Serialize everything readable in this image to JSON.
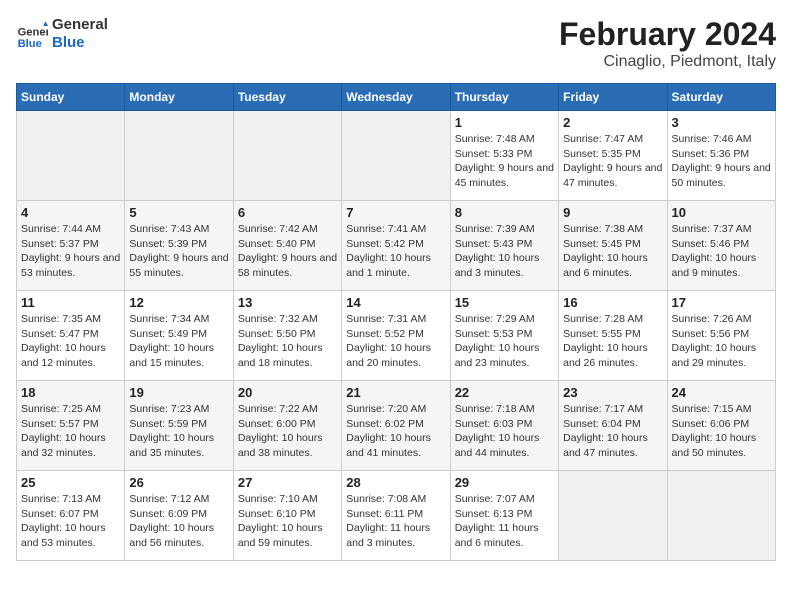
{
  "header": {
    "logo_line1": "General",
    "logo_line2": "Blue",
    "title": "February 2024",
    "subtitle": "Cinaglio, Piedmont, Italy"
  },
  "days_of_week": [
    "Sunday",
    "Monday",
    "Tuesday",
    "Wednesday",
    "Thursday",
    "Friday",
    "Saturday"
  ],
  "weeks": [
    [
      {
        "day": "",
        "info": ""
      },
      {
        "day": "",
        "info": ""
      },
      {
        "day": "",
        "info": ""
      },
      {
        "day": "",
        "info": ""
      },
      {
        "day": "1",
        "info": "Sunrise: 7:48 AM\nSunset: 5:33 PM\nDaylight: 9 hours and 45 minutes."
      },
      {
        "day": "2",
        "info": "Sunrise: 7:47 AM\nSunset: 5:35 PM\nDaylight: 9 hours and 47 minutes."
      },
      {
        "day": "3",
        "info": "Sunrise: 7:46 AM\nSunset: 5:36 PM\nDaylight: 9 hours and 50 minutes."
      }
    ],
    [
      {
        "day": "4",
        "info": "Sunrise: 7:44 AM\nSunset: 5:37 PM\nDaylight: 9 hours and 53 minutes."
      },
      {
        "day": "5",
        "info": "Sunrise: 7:43 AM\nSunset: 5:39 PM\nDaylight: 9 hours and 55 minutes."
      },
      {
        "day": "6",
        "info": "Sunrise: 7:42 AM\nSunset: 5:40 PM\nDaylight: 9 hours and 58 minutes."
      },
      {
        "day": "7",
        "info": "Sunrise: 7:41 AM\nSunset: 5:42 PM\nDaylight: 10 hours and 1 minute."
      },
      {
        "day": "8",
        "info": "Sunrise: 7:39 AM\nSunset: 5:43 PM\nDaylight: 10 hours and 3 minutes."
      },
      {
        "day": "9",
        "info": "Sunrise: 7:38 AM\nSunset: 5:45 PM\nDaylight: 10 hours and 6 minutes."
      },
      {
        "day": "10",
        "info": "Sunrise: 7:37 AM\nSunset: 5:46 PM\nDaylight: 10 hours and 9 minutes."
      }
    ],
    [
      {
        "day": "11",
        "info": "Sunrise: 7:35 AM\nSunset: 5:47 PM\nDaylight: 10 hours and 12 minutes."
      },
      {
        "day": "12",
        "info": "Sunrise: 7:34 AM\nSunset: 5:49 PM\nDaylight: 10 hours and 15 minutes."
      },
      {
        "day": "13",
        "info": "Sunrise: 7:32 AM\nSunset: 5:50 PM\nDaylight: 10 hours and 18 minutes."
      },
      {
        "day": "14",
        "info": "Sunrise: 7:31 AM\nSunset: 5:52 PM\nDaylight: 10 hours and 20 minutes."
      },
      {
        "day": "15",
        "info": "Sunrise: 7:29 AM\nSunset: 5:53 PM\nDaylight: 10 hours and 23 minutes."
      },
      {
        "day": "16",
        "info": "Sunrise: 7:28 AM\nSunset: 5:55 PM\nDaylight: 10 hours and 26 minutes."
      },
      {
        "day": "17",
        "info": "Sunrise: 7:26 AM\nSunset: 5:56 PM\nDaylight: 10 hours and 29 minutes."
      }
    ],
    [
      {
        "day": "18",
        "info": "Sunrise: 7:25 AM\nSunset: 5:57 PM\nDaylight: 10 hours and 32 minutes."
      },
      {
        "day": "19",
        "info": "Sunrise: 7:23 AM\nSunset: 5:59 PM\nDaylight: 10 hours and 35 minutes."
      },
      {
        "day": "20",
        "info": "Sunrise: 7:22 AM\nSunset: 6:00 PM\nDaylight: 10 hours and 38 minutes."
      },
      {
        "day": "21",
        "info": "Sunrise: 7:20 AM\nSunset: 6:02 PM\nDaylight: 10 hours and 41 minutes."
      },
      {
        "day": "22",
        "info": "Sunrise: 7:18 AM\nSunset: 6:03 PM\nDaylight: 10 hours and 44 minutes."
      },
      {
        "day": "23",
        "info": "Sunrise: 7:17 AM\nSunset: 6:04 PM\nDaylight: 10 hours and 47 minutes."
      },
      {
        "day": "24",
        "info": "Sunrise: 7:15 AM\nSunset: 6:06 PM\nDaylight: 10 hours and 50 minutes."
      }
    ],
    [
      {
        "day": "25",
        "info": "Sunrise: 7:13 AM\nSunset: 6:07 PM\nDaylight: 10 hours and 53 minutes."
      },
      {
        "day": "26",
        "info": "Sunrise: 7:12 AM\nSunset: 6:09 PM\nDaylight: 10 hours and 56 minutes."
      },
      {
        "day": "27",
        "info": "Sunrise: 7:10 AM\nSunset: 6:10 PM\nDaylight: 10 hours and 59 minutes."
      },
      {
        "day": "28",
        "info": "Sunrise: 7:08 AM\nSunset: 6:11 PM\nDaylight: 11 hours and 3 minutes."
      },
      {
        "day": "29",
        "info": "Sunrise: 7:07 AM\nSunset: 6:13 PM\nDaylight: 11 hours and 6 minutes."
      },
      {
        "day": "",
        "info": ""
      },
      {
        "day": "",
        "info": ""
      }
    ]
  ]
}
